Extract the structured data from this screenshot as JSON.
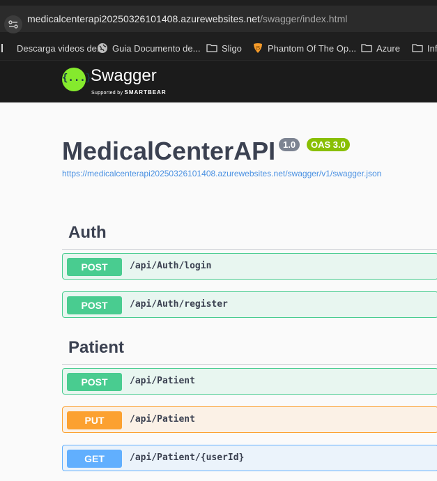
{
  "browser": {
    "url_host": "medicalcenterapi20250326101408.azurewebsites.net",
    "url_path": "/swagger/index.html",
    "bookmarks": [
      {
        "label": "Descarga videos de...",
        "icon": "page-icon"
      },
      {
        "label": "Guia Documento de...",
        "icon": "globe-icon"
      },
      {
        "label": "Sligo",
        "icon": "folder-icon"
      },
      {
        "label": "Phantom Of The Op...",
        "icon": "guitar-pick-icon"
      },
      {
        "label": "Azure",
        "icon": "folder-icon"
      },
      {
        "label": "Inf",
        "icon": "folder-icon"
      }
    ]
  },
  "topbar": {
    "logo_glyph": "{...}",
    "logo_text": "Swagger",
    "supported_by": "Supported by",
    "brand": "SMARTBEAR"
  },
  "info": {
    "title": "MedicalCenterAPI",
    "version": "1.0",
    "oas": "OAS 3.0",
    "spec_url": "https://medicalcenterapi20250326101408.azurewebsites.net/swagger/v1/swagger.json"
  },
  "sections": [
    {
      "name": "Auth",
      "operations": [
        {
          "method": "POST",
          "path": "/api/Auth/login"
        },
        {
          "method": "POST",
          "path": "/api/Auth/register"
        }
      ]
    },
    {
      "name": "Patient",
      "operations": [
        {
          "method": "POST",
          "path": "/api/Patient"
        },
        {
          "method": "PUT",
          "path": "/api/Patient"
        },
        {
          "method": "GET",
          "path": "/api/Patient/{userId}"
        }
      ]
    }
  ],
  "colors": {
    "post": "#49cc90",
    "put": "#fca130",
    "get": "#61affe",
    "swagger_green": "#85ea2d",
    "link": "#4990e2"
  }
}
